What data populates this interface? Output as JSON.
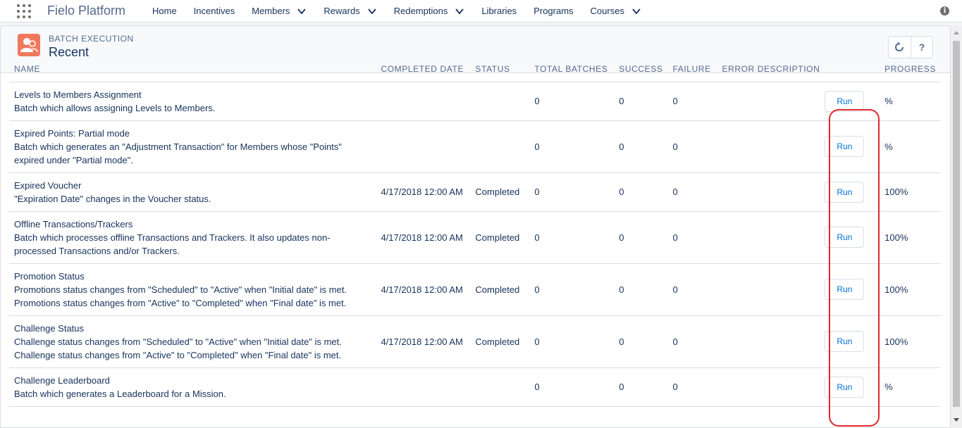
{
  "app": {
    "name": "Fielo Platform"
  },
  "nav": [
    {
      "label": "Home",
      "dropdown": false
    },
    {
      "label": "Incentives",
      "dropdown": false
    },
    {
      "label": "Members",
      "dropdown": true
    },
    {
      "label": "Rewards",
      "dropdown": true
    },
    {
      "label": "Redemptions",
      "dropdown": true
    },
    {
      "label": "Libraries",
      "dropdown": false
    },
    {
      "label": "Programs",
      "dropdown": false
    },
    {
      "label": "Courses",
      "dropdown": true
    }
  ],
  "header": {
    "eyebrow": "BATCH EXECUTION",
    "title": "Recent",
    "help_label": "?"
  },
  "table": {
    "columns": [
      "NAME",
      "COMPLETED DATE",
      "STATUS",
      "TOTAL BATCHES",
      "SUCCESS",
      "FAILURE",
      "ERROR DESCRIPTION",
      "",
      "PROGRESS"
    ],
    "run_label": "Run",
    "rows": [
      {
        "name": "Levels to Members Assignment",
        "desc": "Batch which allows assigning Levels to Members.",
        "completed": "",
        "status": "",
        "total": "0",
        "success": "0",
        "failure": "0",
        "error": "",
        "progress": "%"
      },
      {
        "name": "Expired Points: Partial mode",
        "desc": "Batch which generates an \"Adjustment Transaction\" for Members whose \"Points\" expired under \"Partial mode\".",
        "completed": "",
        "status": "",
        "total": "0",
        "success": "0",
        "failure": "0",
        "error": "",
        "progress": "%"
      },
      {
        "name": "Expired Voucher",
        "desc": "\"Expiration Date\" changes in the Voucher status.",
        "completed": "4/17/2018 12:00 AM",
        "status": "Completed",
        "total": "0",
        "success": "0",
        "failure": "0",
        "error": "",
        "progress": "100%"
      },
      {
        "name": "Offline Transactions/Trackers",
        "desc": "Batch which processes offline Transactions and Trackers. It also updates non-processed Transactions and/or Trackers.",
        "completed": "4/17/2018 12:00 AM",
        "status": "Completed",
        "total": "0",
        "success": "0",
        "failure": "0",
        "error": "",
        "progress": "100%"
      },
      {
        "name": "Promotion Status",
        "desc": "Promotions status changes from \"Scheduled\" to \"Active\" when \"Initial date\" is met. Promotions status changes from \"Active\" to \"Completed\" when \"Final date\" is met.",
        "completed": "4/17/2018 12:00 AM",
        "status": "Completed",
        "total": "0",
        "success": "0",
        "failure": "0",
        "error": "",
        "progress": "100%"
      },
      {
        "name": "Challenge Status",
        "desc": "Challenge status changes from \"Scheduled\" to \"Active\" when \"Initial date\" is met. Challenge status changes from \"Active\" to \"Completed\" when \"Final date\" is met.",
        "completed": "4/17/2018 12:00 AM",
        "status": "Completed",
        "total": "0",
        "success": "0",
        "failure": "0",
        "error": "",
        "progress": "100%"
      },
      {
        "name": "Challenge Leaderboard",
        "desc": "Batch which generates a Leaderboard for a Mission.",
        "completed": "",
        "status": "",
        "total": "0",
        "success": "0",
        "failure": "0",
        "error": "",
        "progress": "%"
      }
    ]
  },
  "colors": {
    "highlight": "#e0282e",
    "accent": "#0070d2",
    "object_icon": "#f0795d"
  }
}
